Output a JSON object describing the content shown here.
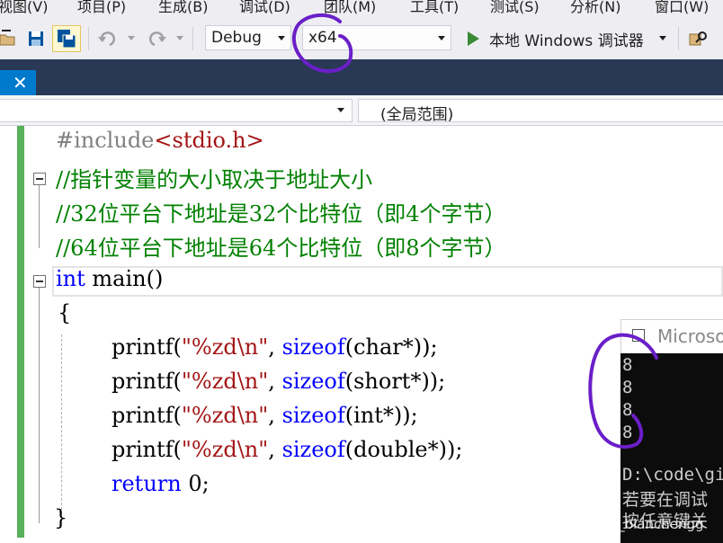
{
  "menu": {
    "items": [
      "视图(V)",
      "项目(P)",
      "生成(B)",
      "调试(D)",
      "团队(M)",
      "工具(T)",
      "测试(S)",
      "分析(N)",
      "窗口(W)"
    ]
  },
  "toolbar": {
    "configuration": "Debug",
    "platform": "x64",
    "run_label": "本地 Windows 调试器"
  },
  "navbar": {
    "scope": "(全局范围)"
  },
  "code": {
    "include_directive": "#include",
    "include_file": "<stdio.h>",
    "comment1": "//指针变量的大小取决于地址大小",
    "comment2": "//32位平台下地址是32个比特位（即4个字节）",
    "comment3": "//64位平台下地址是64个比特位（即8个字节）",
    "kw_int": "int",
    "main_sig": " main()",
    "open_brace": "{",
    "printf": "printf(",
    "format_str": "\"%zd\\n\"",
    "comma": ", ",
    "sizeof": "sizeof",
    "args": [
      "(char*));",
      "(short*));",
      "(int*));",
      "(double*));"
    ],
    "kw_return": "return",
    "return_val": " 0;",
    "close_brace": "}"
  },
  "console": {
    "title": "Microsoft",
    "outputs": [
      "8",
      "8",
      "8",
      "8"
    ],
    "path_line": "D:\\code\\gi",
    "hint1": "若要在调试",
    "hint2": "按任意键关"
  },
  "watermark": "CSDN @syz_bianchengg",
  "colors": {
    "keyword": "#0000ff",
    "string": "#a31515",
    "comment": "#008000",
    "annotation": "#6a1fc8"
  }
}
